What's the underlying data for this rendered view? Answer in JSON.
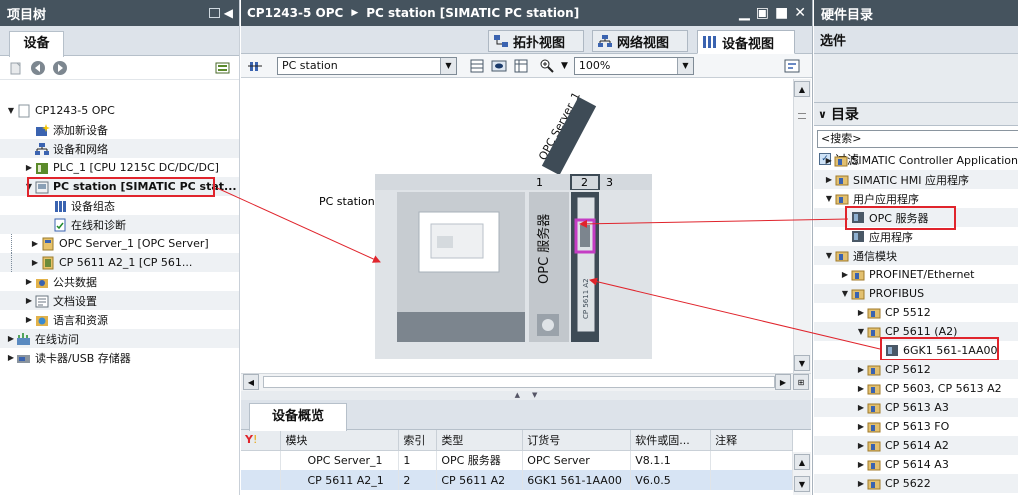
{
  "left": {
    "title": "项目树",
    "tab": "设备",
    "tree": [
      {
        "label": "CP1243-5 OPC",
        "toggle": "▼",
        "icon": "project-icon"
      },
      {
        "label": "添加新设备",
        "toggle": "",
        "icon": "add-device-icon"
      },
      {
        "label": "设备和网络",
        "toggle": "",
        "icon": "network-icon"
      },
      {
        "label": "PLC_1 [CPU 1215C DC/DC/DC]",
        "toggle": "▶",
        "icon": "plc-icon"
      },
      {
        "label": "PC station [SIMATIC PC stat...",
        "toggle": "▼",
        "icon": "pc-station-icon"
      },
      {
        "label": "设备组态",
        "toggle": "",
        "icon": "device-config-icon"
      },
      {
        "label": "在线和诊断",
        "toggle": "",
        "icon": "online-diag-icon"
      },
      {
        "label": "OPC Server_1 [OPC Server]",
        "toggle": "▶",
        "icon": "opc-server-icon"
      },
      {
        "label": "CP 5611 A2_1 [CP 561...",
        "toggle": "▶",
        "icon": "cp-card-icon"
      },
      {
        "label": "公共数据",
        "toggle": "▶",
        "icon": "common-data-icon"
      },
      {
        "label": "文档设置",
        "toggle": "▶",
        "icon": "doc-settings-icon"
      },
      {
        "label": "语言和资源",
        "toggle": "▶",
        "icon": "language-icon"
      },
      {
        "label": "在线访问",
        "toggle": "▶",
        "icon": "online-access-icon"
      },
      {
        "label": "读卡器/USB 存储器",
        "toggle": "▶",
        "icon": "card-reader-icon"
      }
    ]
  },
  "center": {
    "title": "CP1243-5 OPC",
    "subtitle": "PC station [SIMATIC PC station]",
    "view_tabs": [
      "拓扑视图",
      "网络视图",
      "设备视图"
    ],
    "device_combo": "PC station",
    "zoom_combo": "100%",
    "canvas": {
      "station_label": "PC station",
      "slot_numbers": [
        "1",
        "2",
        "3"
      ],
      "rotated_label_1": "OPC Server_1",
      "rotated_label_2": "CP 5611 A2_1",
      "module_text": "OPC 服务器",
      "card_text": "CP 5611 A2"
    },
    "overview": {
      "tab": "设备概览",
      "columns": [
        "模块",
        "索引",
        "类型",
        "订货号",
        "软件或固...",
        "注释"
      ],
      "rows": [
        [
          "OPC Server_1",
          "1",
          "OPC 服务器",
          "OPC Server",
          "V8.1.1",
          ""
        ],
        [
          "CP 5611 A2_1",
          "2",
          "CP 5611 A2",
          "6GK1 561-1AA00",
          "V6.0.5",
          ""
        ]
      ]
    }
  },
  "right": {
    "title": "硬件目录",
    "options": "选件",
    "catalog": "目录",
    "search_placeholder": "<搜索>",
    "filter": "过滤",
    "tree": [
      {
        "label": "SIMATIC Controller Application",
        "toggle": "▶",
        "indent": 1
      },
      {
        "label": "SIMATIC HMI 应用程序",
        "toggle": "▶",
        "indent": 1
      },
      {
        "label": "用户应用程序",
        "toggle": "▼",
        "indent": 1
      },
      {
        "label": "OPC 服务器",
        "toggle": "",
        "indent": 2,
        "leaf": true
      },
      {
        "label": "应用程序",
        "toggle": "",
        "indent": 2,
        "leaf": true
      },
      {
        "label": "通信模块",
        "toggle": "▼",
        "indent": 1
      },
      {
        "label": "PROFINET/Ethernet",
        "toggle": "▶",
        "indent": 2
      },
      {
        "label": "PROFIBUS",
        "toggle": "▼",
        "indent": 2
      },
      {
        "label": "CP 5512",
        "toggle": "▶",
        "indent": 3
      },
      {
        "label": "CP 5611 (A2)",
        "toggle": "▼",
        "indent": 3
      },
      {
        "label": "6GK1 561-1AA00",
        "toggle": "",
        "indent": 4,
        "leaf": true
      },
      {
        "label": "CP 5612",
        "toggle": "▶",
        "indent": 3
      },
      {
        "label": "CP 5603, CP 5613 A2",
        "toggle": "▶",
        "indent": 3
      },
      {
        "label": "CP 5613 A3",
        "toggle": "▶",
        "indent": 3
      },
      {
        "label": "CP 5613 FO",
        "toggle": "▶",
        "indent": 3
      },
      {
        "label": "CP 5614 A2",
        "toggle": "▶",
        "indent": 3
      },
      {
        "label": "CP 5614 A3",
        "toggle": "▶",
        "indent": 3
      },
      {
        "label": "CP 5622",
        "toggle": "▶",
        "indent": 3
      }
    ]
  },
  "colors": {
    "header_bg": "#45535e",
    "highlight_red": "#e0242c",
    "selection_blue": "#d7e4f4",
    "module_magenta": "#c43cc4"
  }
}
